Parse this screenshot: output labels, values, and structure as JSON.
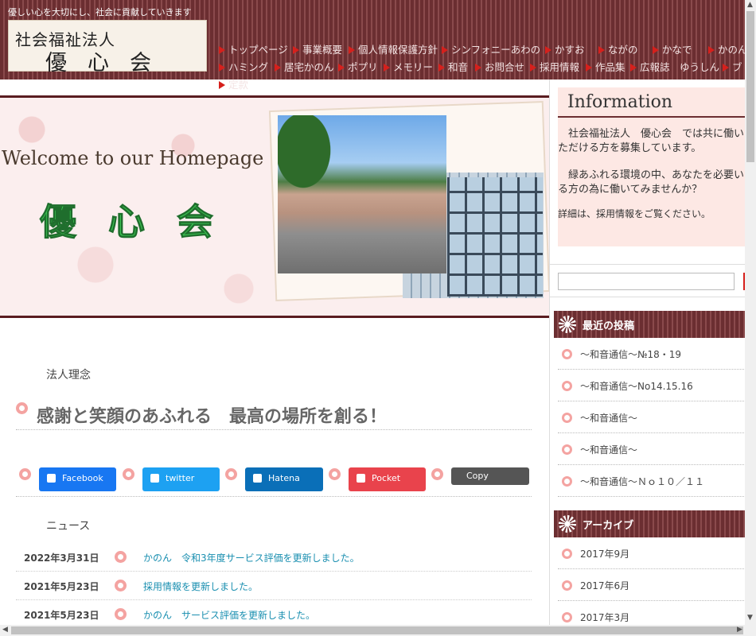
{
  "header": {
    "tagline": "優しい心を大切にし、社会に貢献していきます",
    "logo_line1": "社会福祉法人",
    "logo_line2": "優心会"
  },
  "nav": {
    "items": [
      "トップページ",
      "事業概要",
      "個人情報保護方針",
      "シンフォニーあわの",
      "かすお",
      "ながの",
      "かなで",
      "かのん",
      "ハミング",
      "居宅かのん",
      "ポプリ",
      "メモリー",
      "和音",
      "お問合せ",
      "採用情報",
      "作品集",
      "広報誌　ゆうしん",
      "ブ",
      "定款"
    ]
  },
  "hero": {
    "welcome": "Welcome to our Homepage",
    "brand": "優心会"
  },
  "main": {
    "philosophy_label": "法人理念",
    "philosophy_heading": "感謝と笑顔のあふれる　最高の場所を創る！",
    "share": {
      "facebook": "Facebook",
      "twitter": "twitter",
      "hatena": "Hatena",
      "pocket": "Pocket",
      "copy": "Copy"
    },
    "news_label": "ニュース",
    "news": [
      {
        "date": "2022年3月31日",
        "text": "かのん　令和3年度サービス評価を更新しました。"
      },
      {
        "date": "2021年5月23日",
        "text": "採用情報を更新しました。"
      },
      {
        "date": "2021年5月23日",
        "text": "かのん　サービス評価を更新しました。"
      }
    ]
  },
  "sidebar": {
    "info_title": "Information",
    "info_p1": "　社会福祉法人　優心会　では共に働いただける方を募集しています。",
    "info_p2": "　緑あふれる環境の中、あなたを必要いる方の為に働いてみませんか？",
    "info_p3": "詳細は、採用情報をご覧ください。",
    "recent_title": "最近の投稿",
    "recent": [
      "～和音通信～№18・19",
      "～和音通信～No14.15.16",
      "～和音通信～",
      "～和音通信～",
      "～和音通信～Ｎｏ１０／１１"
    ],
    "archive_title": "アーカイブ",
    "archives": [
      "2017年9月",
      "2017年6月",
      "2017年3月"
    ]
  },
  "colors": {
    "header_bg": "#6b2e31",
    "accent_red": "#d6201c",
    "bullet_pink": "#f4a3a1",
    "link_blue": "#1a8fb0",
    "brand_green": "#3cc552"
  }
}
